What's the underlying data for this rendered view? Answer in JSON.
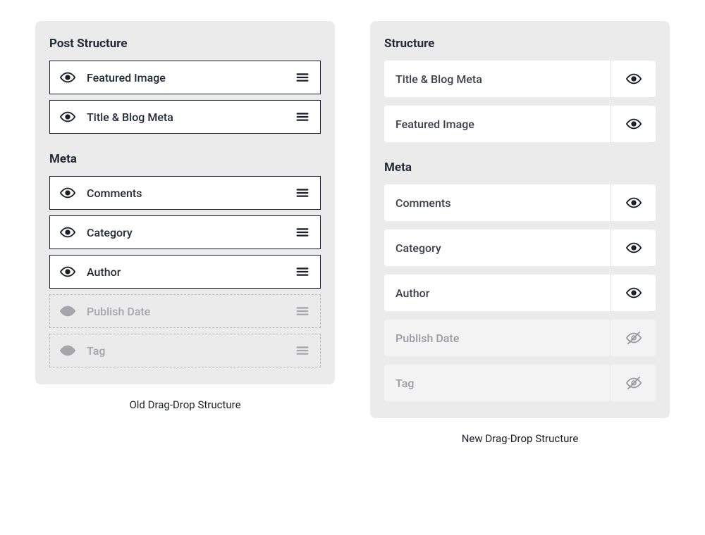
{
  "old": {
    "section1_title": "Post Structure",
    "section2_title": "Meta",
    "structure": [
      {
        "label": "Featured Image",
        "visible": true
      },
      {
        "label": "Title & Blog Meta",
        "visible": true
      }
    ],
    "meta": [
      {
        "label": "Comments",
        "visible": true
      },
      {
        "label": "Category",
        "visible": true
      },
      {
        "label": "Author",
        "visible": true
      },
      {
        "label": "Publish Date",
        "visible": false
      },
      {
        "label": "Tag",
        "visible": false
      }
    ],
    "caption": "Old Drag-Drop Structure"
  },
  "new": {
    "section1_title": "Structure",
    "section2_title": "Meta",
    "structure": [
      {
        "label": "Title & Blog Meta",
        "visible": true
      },
      {
        "label": "Featured Image",
        "visible": true
      }
    ],
    "meta": [
      {
        "label": "Comments",
        "visible": true
      },
      {
        "label": "Category",
        "visible": true
      },
      {
        "label": "Author",
        "visible": true
      },
      {
        "label": "Publish Date",
        "visible": false
      },
      {
        "label": "Tag",
        "visible": false
      }
    ],
    "caption": "New Drag-Drop Structure"
  }
}
